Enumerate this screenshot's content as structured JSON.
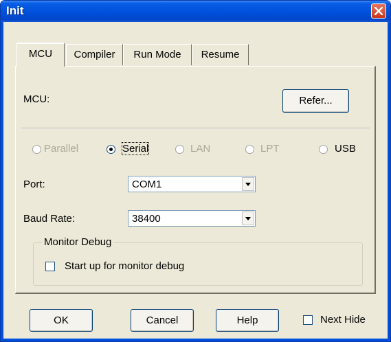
{
  "window": {
    "title": "Init"
  },
  "tabs": [
    {
      "label": "MCU",
      "active": true
    },
    {
      "label": "Compiler",
      "active": false
    },
    {
      "label": "Run Mode",
      "active": false
    },
    {
      "label": "Resume",
      "active": false
    }
  ],
  "mcu": {
    "label": "MCU:",
    "refer_button": "Refer..."
  },
  "connection": {
    "options": [
      {
        "label": "Parallel",
        "enabled": false,
        "selected": false
      },
      {
        "label": "Serial",
        "enabled": true,
        "selected": true
      },
      {
        "label": "LAN",
        "enabled": false,
        "selected": false
      },
      {
        "label": "LPT",
        "enabled": false,
        "selected": false
      },
      {
        "label": "USB",
        "enabled": true,
        "selected": false
      }
    ]
  },
  "port": {
    "label": "Port:",
    "value": "COM1"
  },
  "baud_rate": {
    "label": "Baud Rate:",
    "value": "38400"
  },
  "monitor_debug": {
    "group_title": "Monitor Debug",
    "checkbox_label": "Start up for monitor debug",
    "checked": false
  },
  "footer": {
    "ok": "OK",
    "cancel": "Cancel",
    "help": "Help",
    "next_hide_label": "Next Hide",
    "next_hide_checked": false
  },
  "colors": {
    "titlebar": "#0050dc",
    "dialog_bg": "#ece9d8",
    "close_button": "#c9371b"
  }
}
